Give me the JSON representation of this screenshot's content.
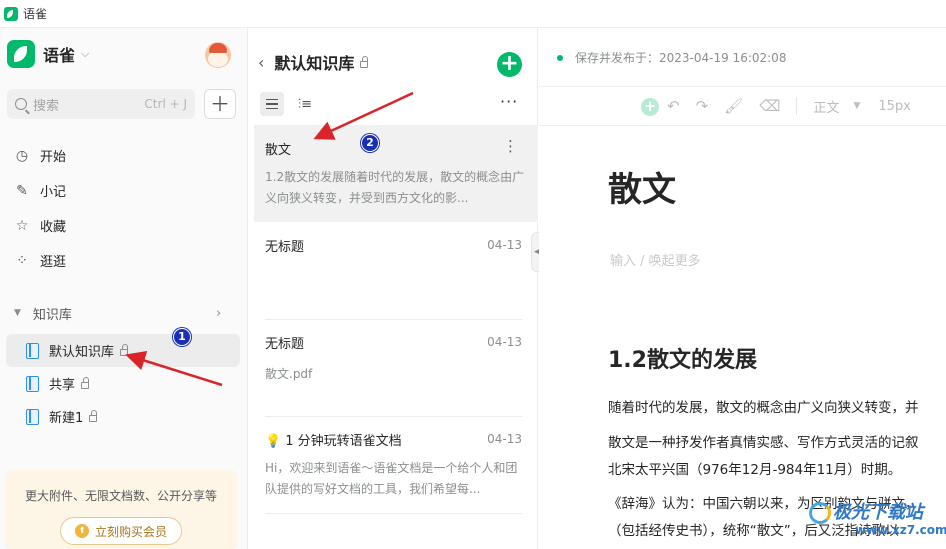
{
  "window": {
    "title": "语雀"
  },
  "sidebar": {
    "brand": "语雀",
    "search": {
      "placeholder": "搜索",
      "shortcut": "Ctrl + J"
    },
    "nav": [
      {
        "label": "开始",
        "icon": "clock-icon"
      },
      {
        "label": "小记",
        "icon": "feather-icon"
      },
      {
        "label": "收藏",
        "icon": "star-icon"
      },
      {
        "label": "逛逛",
        "icon": "grid-icon"
      }
    ],
    "kb_section": "知识库",
    "kb_items": [
      {
        "label": "默认知识库",
        "active": true
      },
      {
        "label": "共享",
        "active": false
      },
      {
        "label": "新建1",
        "active": false
      }
    ],
    "promo": {
      "text": "更大附件、无限文档数、公开分享等",
      "button": "立刻购买会员"
    }
  },
  "doclist": {
    "title": "默认知识库",
    "docs": [
      {
        "title": "散文",
        "date": "",
        "summary": "1.2散文的发展随着时代的发展，散文的概念由广义向狭义转变，并受到西方文化的影...",
        "selected": true
      },
      {
        "title": "无标题",
        "date": "04-13",
        "summary": ""
      },
      {
        "title": "无标题",
        "date": "04-13",
        "file": "散文.pdf"
      },
      {
        "title": "1 分钟玩转语雀文档",
        "date": "04-13",
        "summary": "Hi，欢迎来到语雀～语雀文档是一个给个人和团队提供的写好文档的工具，我们希望每..."
      }
    ]
  },
  "editor": {
    "status": "保存并发布于：2023-04-19 16:02:08",
    "toolbar": {
      "paragraph": "正文",
      "font_size": "15px"
    },
    "title": "散文",
    "placeholder": "输入 / 唤起更多",
    "heading": "1.2散文的发展",
    "paragraphs": [
      "随着时代的发展，散文的概念由广义向狭义转变，并",
      "散文是一种抒发作者真情实感、写作方式灵活的记叙",
      "北宋太平兴国（976年12月-984年11月）时期。",
      "《辞海》认为：中国六朝以来，为区别韵文与骈文，",
      "（包括经传史书），统称“散文”，后又泛指诗歌以"
    ]
  },
  "annotations": {
    "badge1": "1",
    "badge2": "2",
    "arrow_color": "#d9252a"
  },
  "watermark": {
    "line1": "极光下载站",
    "line2": "www.xz7.com"
  }
}
